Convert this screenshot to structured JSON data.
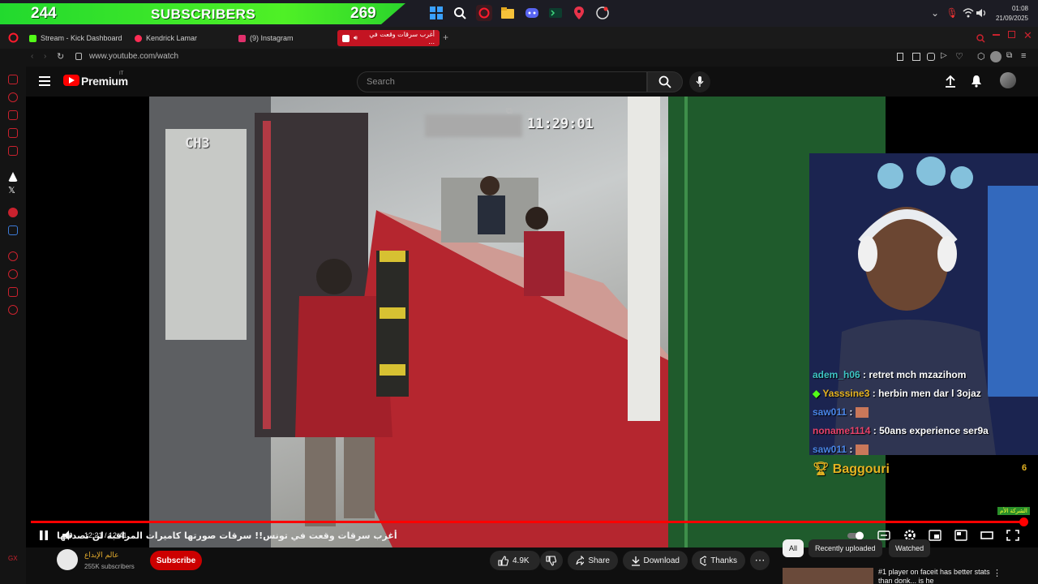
{
  "taskbar": {
    "sub_current": "244",
    "sub_label": "SUBSCRIBERS",
    "sub_goal": "269",
    "clock_time": "01:08",
    "clock_date": "21/09/2025"
  },
  "tabs": [
    {
      "label": "Stream - Kick Dashboard",
      "color": "#53fc18"
    },
    {
      "label": "Kendrick Lamar",
      "color": "#ff2d55"
    },
    {
      "label": "(9) Instagram",
      "color": "#e1306c"
    },
    {
      "label": "أغرب سرقات وقعت في ...",
      "color": "#ff0000"
    }
  ],
  "address": {
    "url": "www.youtube.com/watch"
  },
  "youtube": {
    "brand": "Premium",
    "country": "IT",
    "search_placeholder": "Search"
  },
  "video": {
    "overlay_channel": "CH3",
    "overlay_clock": "11:29:01",
    "time": "12:21 / 12:41",
    "corner_badge": "الشركة الأم",
    "progress": 0.973
  },
  "chat": [
    {
      "user": "adem_h06",
      "text": ": retret mch mzazihom",
      "color": "#3ec4c4"
    },
    {
      "user": "Yasssine3",
      "text": ": herbin men dar l 3ojaz",
      "color": "#e6b422"
    },
    {
      "user": "saw011",
      "text": ":",
      "color": "#4a86e8"
    },
    {
      "user": "noname1114",
      "text": ": 50ans experience ser9a",
      "color": "#e8436b"
    },
    {
      "user": "saw011",
      "text": ":",
      "color": "#4a86e8"
    }
  ],
  "alert": {
    "name": "Baggouri",
    "count": "6"
  },
  "below": {
    "title": "أغرب سرقات وقعت في تونس!! سرقات صورتها كاميرات المراقبة لن تصدقها",
    "channel": "عالم الإبداع",
    "subscribers": "255K subscribers",
    "subscribe": "Subscribe",
    "likes": "4.9K",
    "share": "Share",
    "download": "Download",
    "thanks": "Thanks"
  },
  "chips": [
    "All",
    "Recently uploaded",
    "Watched"
  ],
  "recommended": {
    "title": "#1 player on faceit has better stats than donk... is he"
  }
}
